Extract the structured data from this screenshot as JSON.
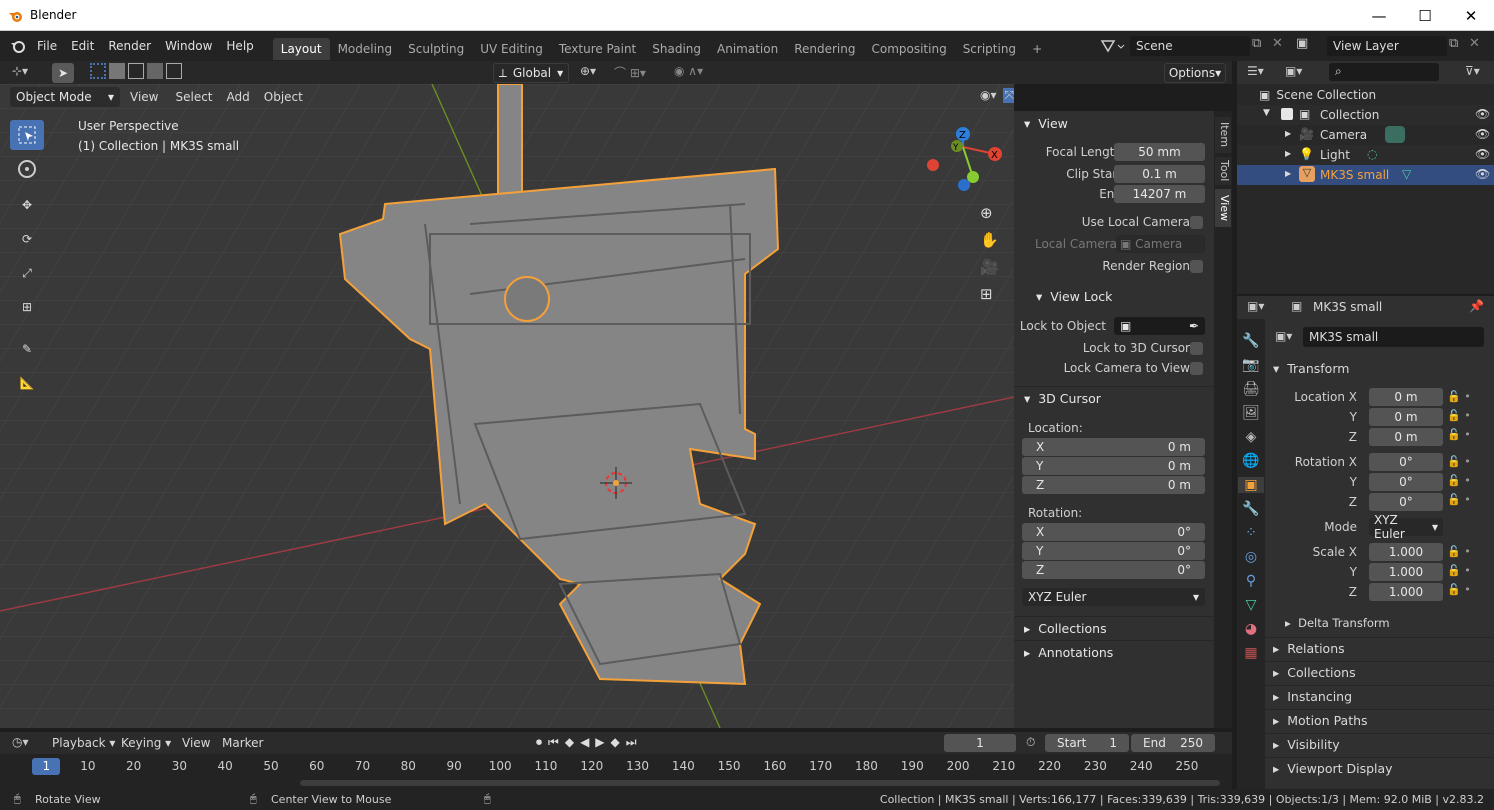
{
  "window": {
    "title": "Blender",
    "min": "—",
    "max": "☐",
    "close": "✕"
  },
  "menu": [
    "File",
    "Edit",
    "Render",
    "Window",
    "Help"
  ],
  "workspaces": [
    "Layout",
    "Modeling",
    "Sculpting",
    "UV Editing",
    "Texture Paint",
    "Shading",
    "Animation",
    "Rendering",
    "Compositing",
    "Scripting"
  ],
  "workspace_add": "+",
  "scene": "Scene",
  "view_layer": "View Layer",
  "toolbar": {
    "orientation": "Global",
    "options": "Options"
  },
  "vp_header": {
    "mode": "Object Mode",
    "view": "View",
    "select": "Select",
    "add": "Add",
    "object": "Object"
  },
  "viewport": {
    "line1": "User Perspective",
    "line2": "(1) Collection | MK3S small"
  },
  "gizmo": {
    "z": "Z",
    "y": "Y",
    "x": "X"
  },
  "npanel": {
    "tabs": [
      "Item",
      "Tool",
      "View"
    ],
    "view": "View",
    "focal_label": "Focal Length",
    "focal": "50 mm",
    "clip_start_label": "Clip Start",
    "clip_start": "0.1 m",
    "end_label": "End",
    "end": "14207 m",
    "use_local_camera": "Use Local Camera",
    "local_camera": "Local Camera",
    "camera": "Camera",
    "render_region": "Render Region",
    "view_lock": "View Lock",
    "lock_object": "Lock to Object",
    "lock_cursor": "Lock to 3D Cursor",
    "lock_cam": "Lock Camera to View",
    "cursor": "3D Cursor",
    "location": "Location:",
    "rotation": "Rotation:",
    "loc": [
      {
        "a": "X",
        "v": "0 m"
      },
      {
        "a": "Y",
        "v": "0 m"
      },
      {
        "a": "Z",
        "v": "0 m"
      }
    ],
    "rot": [
      {
        "a": "X",
        "v": "0°"
      },
      {
        "a": "Y",
        "v": "0°"
      },
      {
        "a": "Z",
        "v": "0°"
      }
    ],
    "euler": "XYZ Euler",
    "collections": "Collections",
    "annotations": "Annotations"
  },
  "outliner": {
    "scene_collection": "Scene Collection",
    "collection": "Collection",
    "camera": "Camera",
    "light": "Light",
    "mk3s": "MK3S small"
  },
  "props": {
    "object": "MK3S small",
    "name": "MK3S small",
    "transform": "Transform",
    "locx": "Location X",
    "y": "Y",
    "z": "Z",
    "rotx": "Rotation X",
    "mode": "Mode",
    "scalex": "Scale X",
    "loc": [
      "0 m",
      "0 m",
      "0 m"
    ],
    "rot": [
      "0°",
      "0°",
      "0°"
    ],
    "mode_val": "XYZ Euler",
    "scale": [
      "1.000",
      "1.000",
      "1.000"
    ],
    "delta": "Delta Transform",
    "sections": [
      "Relations",
      "Collections",
      "Instancing",
      "Motion Paths",
      "Visibility",
      "Viewport Display"
    ]
  },
  "timeline": {
    "playback": "Playback",
    "keying": "Keying",
    "view": "View",
    "marker": "Marker",
    "frame": "1",
    "start_label": "Start",
    "start": "1",
    "end_label": "End",
    "end": "250",
    "ticks": [
      "1",
      "10",
      "20",
      "30",
      "40",
      "50",
      "60",
      "70",
      "80",
      "90",
      "100",
      "110",
      "120",
      "130",
      "140",
      "150",
      "160",
      "170",
      "180",
      "190",
      "200",
      "210",
      "220",
      "230",
      "240",
      "250"
    ]
  },
  "status": {
    "left": "Rotate View",
    "mid": "Center View to Mouse",
    "right": "Collection | MK3S small | Verts:166,177 | Faces:339,639 | Tris:339,639 | Objects:1/3 | Mem: 92.0 MiB | v2.83.2"
  },
  "colors": {
    "accent": "#f5a13a",
    "select": "#4772b3",
    "bg": "#393939"
  }
}
